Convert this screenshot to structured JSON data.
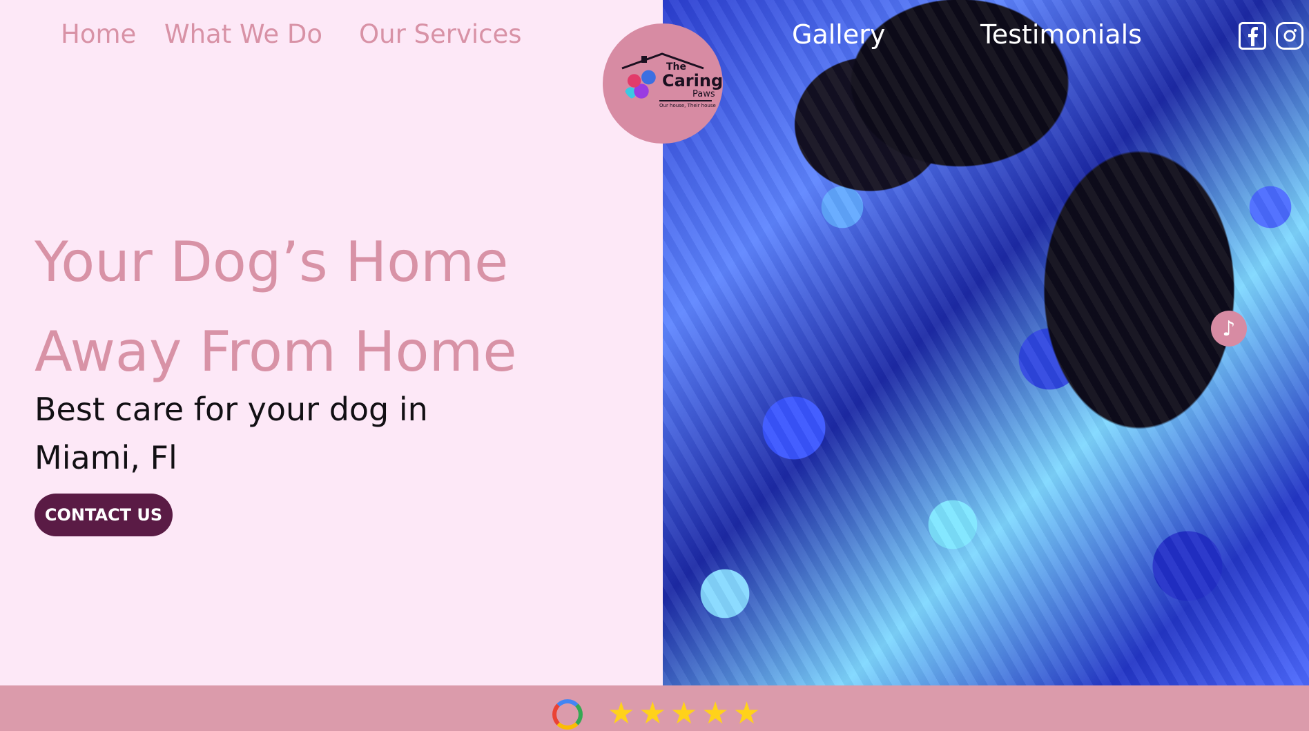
{
  "nav": {
    "home": "Home",
    "what_we_do": "What We Do",
    "our_services": "Our Services",
    "gallery": "Gallery",
    "testimonials": "Testimonials"
  },
  "logo": {
    "the": "The",
    "caring": "Caring",
    "paws": "Paws",
    "tagline": "Our house, Their house"
  },
  "social": {
    "facebook_icon": "facebook-icon",
    "instagram_icon": "instagram-icon"
  },
  "hero": {
    "title_line1": "Your Dog’s Home",
    "title_line2": "Away From Home",
    "subtitle": "Best care for your dog in Miami, Fl",
    "cta_label": "CONTACT US"
  },
  "music_button": {
    "icon": "music-note-icon",
    "glyph": "♪"
  },
  "reviews": {
    "google_icon": "google-icon",
    "stars": "★★★★★",
    "rating": 5
  },
  "colors": {
    "background": "#fde8f7",
    "accent_pink": "#d892a6",
    "cta": "#5a1b45",
    "bottom_bar": "#db9bab",
    "star": "#ffd21a"
  }
}
